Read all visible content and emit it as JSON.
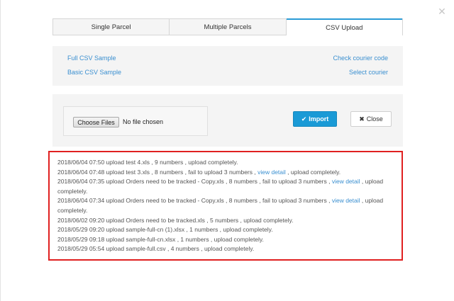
{
  "icons": {
    "modal_close": "✕",
    "import": "✔",
    "close": "✖"
  },
  "tabs": [
    {
      "label": "Single Parcel"
    },
    {
      "label": "Multiple Parcels"
    },
    {
      "label": "CSV Upload"
    }
  ],
  "links": {
    "full_csv": "Full CSV Sample",
    "basic_csv": "Basic CSV Sample",
    "check_courier": "Check courier code",
    "select_courier": "Select courier"
  },
  "upload": {
    "choose_label": "Choose Files",
    "file_status": "No file chosen",
    "import_label": "Import",
    "close_label": "Close"
  },
  "log": [
    {
      "text": "2018/06/04 07:50 upload test 4.xls , 9 numbers , upload completely."
    },
    {
      "text": "2018/06/04 07:48 upload test 3.xls , 8 numbers , fail to upload 3 numbers , ",
      "link": "view detail",
      "after": " , upload completely."
    },
    {
      "text": "2018/06/04 07:35 upload Orders need to be tracked - Copy.xls , 8 numbers , fail to upload 3 numbers , ",
      "link": "view detail",
      "after": " , upload completely."
    },
    {
      "text": "2018/06/04 07:34 upload Orders need to be tracked - Copy.xls , 8 numbers , fail to upload 3 numbers , ",
      "link": "view detail",
      "after": " , upload completely."
    },
    {
      "text": "2018/06/02 09:20 upload Orders need to be tracked.xls , 5 numbers , upload completely."
    },
    {
      "text": "2018/05/29 09:20 upload sample-full-cn (1).xlsx , 1 numbers , upload completely."
    },
    {
      "text": "2018/05/29 09:18 upload sample-full-cn.xlsx , 1 numbers , upload completely."
    },
    {
      "text": "2018/05/29 05:54 upload sample-full.csv , 4 numbers , upload completely."
    }
  ]
}
